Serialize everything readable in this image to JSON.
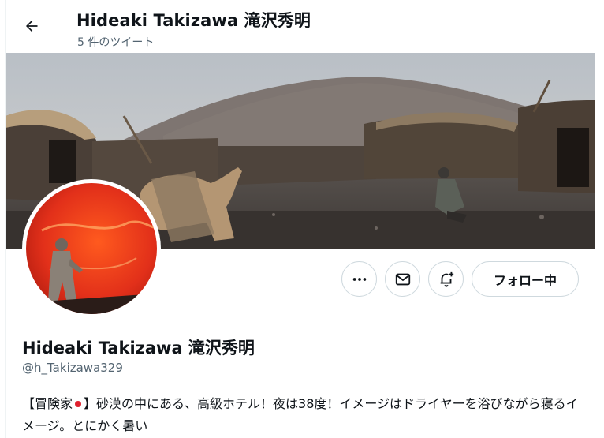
{
  "header": {
    "title": "Hideaki Takizawa 滝沢秀明",
    "subtitle": "5 件のツイート"
  },
  "profile": {
    "display_name": "Hideaki Takizawa 滝沢秀明",
    "handle": "@h_Takizawa329",
    "bio_prefix": "【冒険家",
    "bio_main": "】砂漠の中にある、高級ホテル！夜は38度！イメージはドライヤーを浴びながら寝るイメージ。とにかく暑い"
  },
  "actions": {
    "more_icon": "more-dots-icon",
    "message_icon": "envelope-icon",
    "notify_icon": "bell-plus-icon",
    "follow_label": "フォロー中"
  },
  "colors": {
    "text": "#0f1419",
    "muted": "#536471",
    "border": "#cfd9de",
    "flag_red": "#e0202e"
  }
}
